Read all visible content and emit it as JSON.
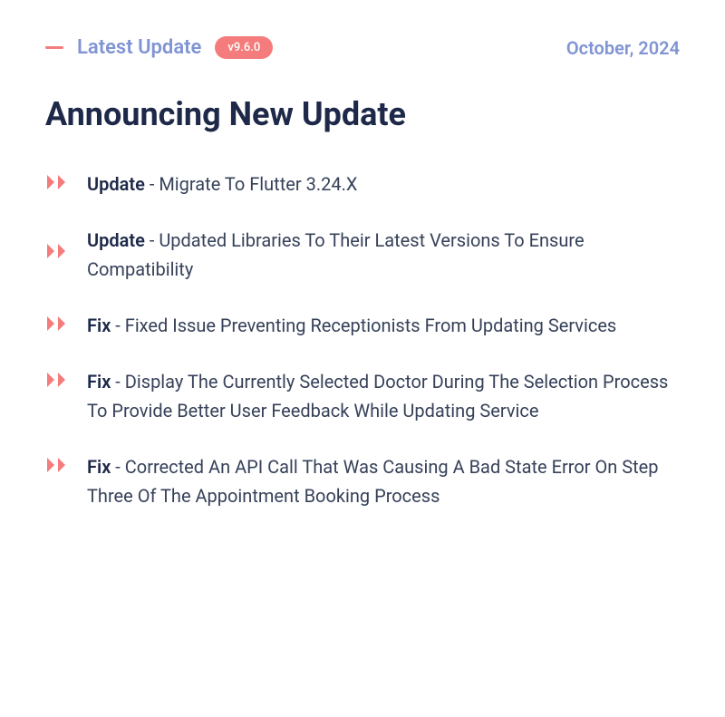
{
  "header": {
    "section_label": "Latest Update",
    "version": "v9.6.0",
    "date": "October, 2024"
  },
  "title": "Announcing New Update",
  "items": [
    {
      "prefix": "Update",
      "text": "Migrate To Flutter 3.24.X",
      "multiline": false
    },
    {
      "prefix": "Update",
      "text": "Updated Libraries To Their Latest Versions To Ensure Compatibility",
      "multiline": true
    },
    {
      "prefix": "Fix",
      "text": "Fixed Issue Preventing Receptionists From Updating Services",
      "multiline": false
    },
    {
      "prefix": "Fix",
      "text": "Display The Currently Selected Doctor During The Selection Process To Provide Better User Feedback While Updating Service",
      "multiline": false
    },
    {
      "prefix": "Fix",
      "text": "Corrected An API Call That Was Causing A Bad State Error On Step Three Of The Appointment Booking Process",
      "multiline": false
    }
  ]
}
